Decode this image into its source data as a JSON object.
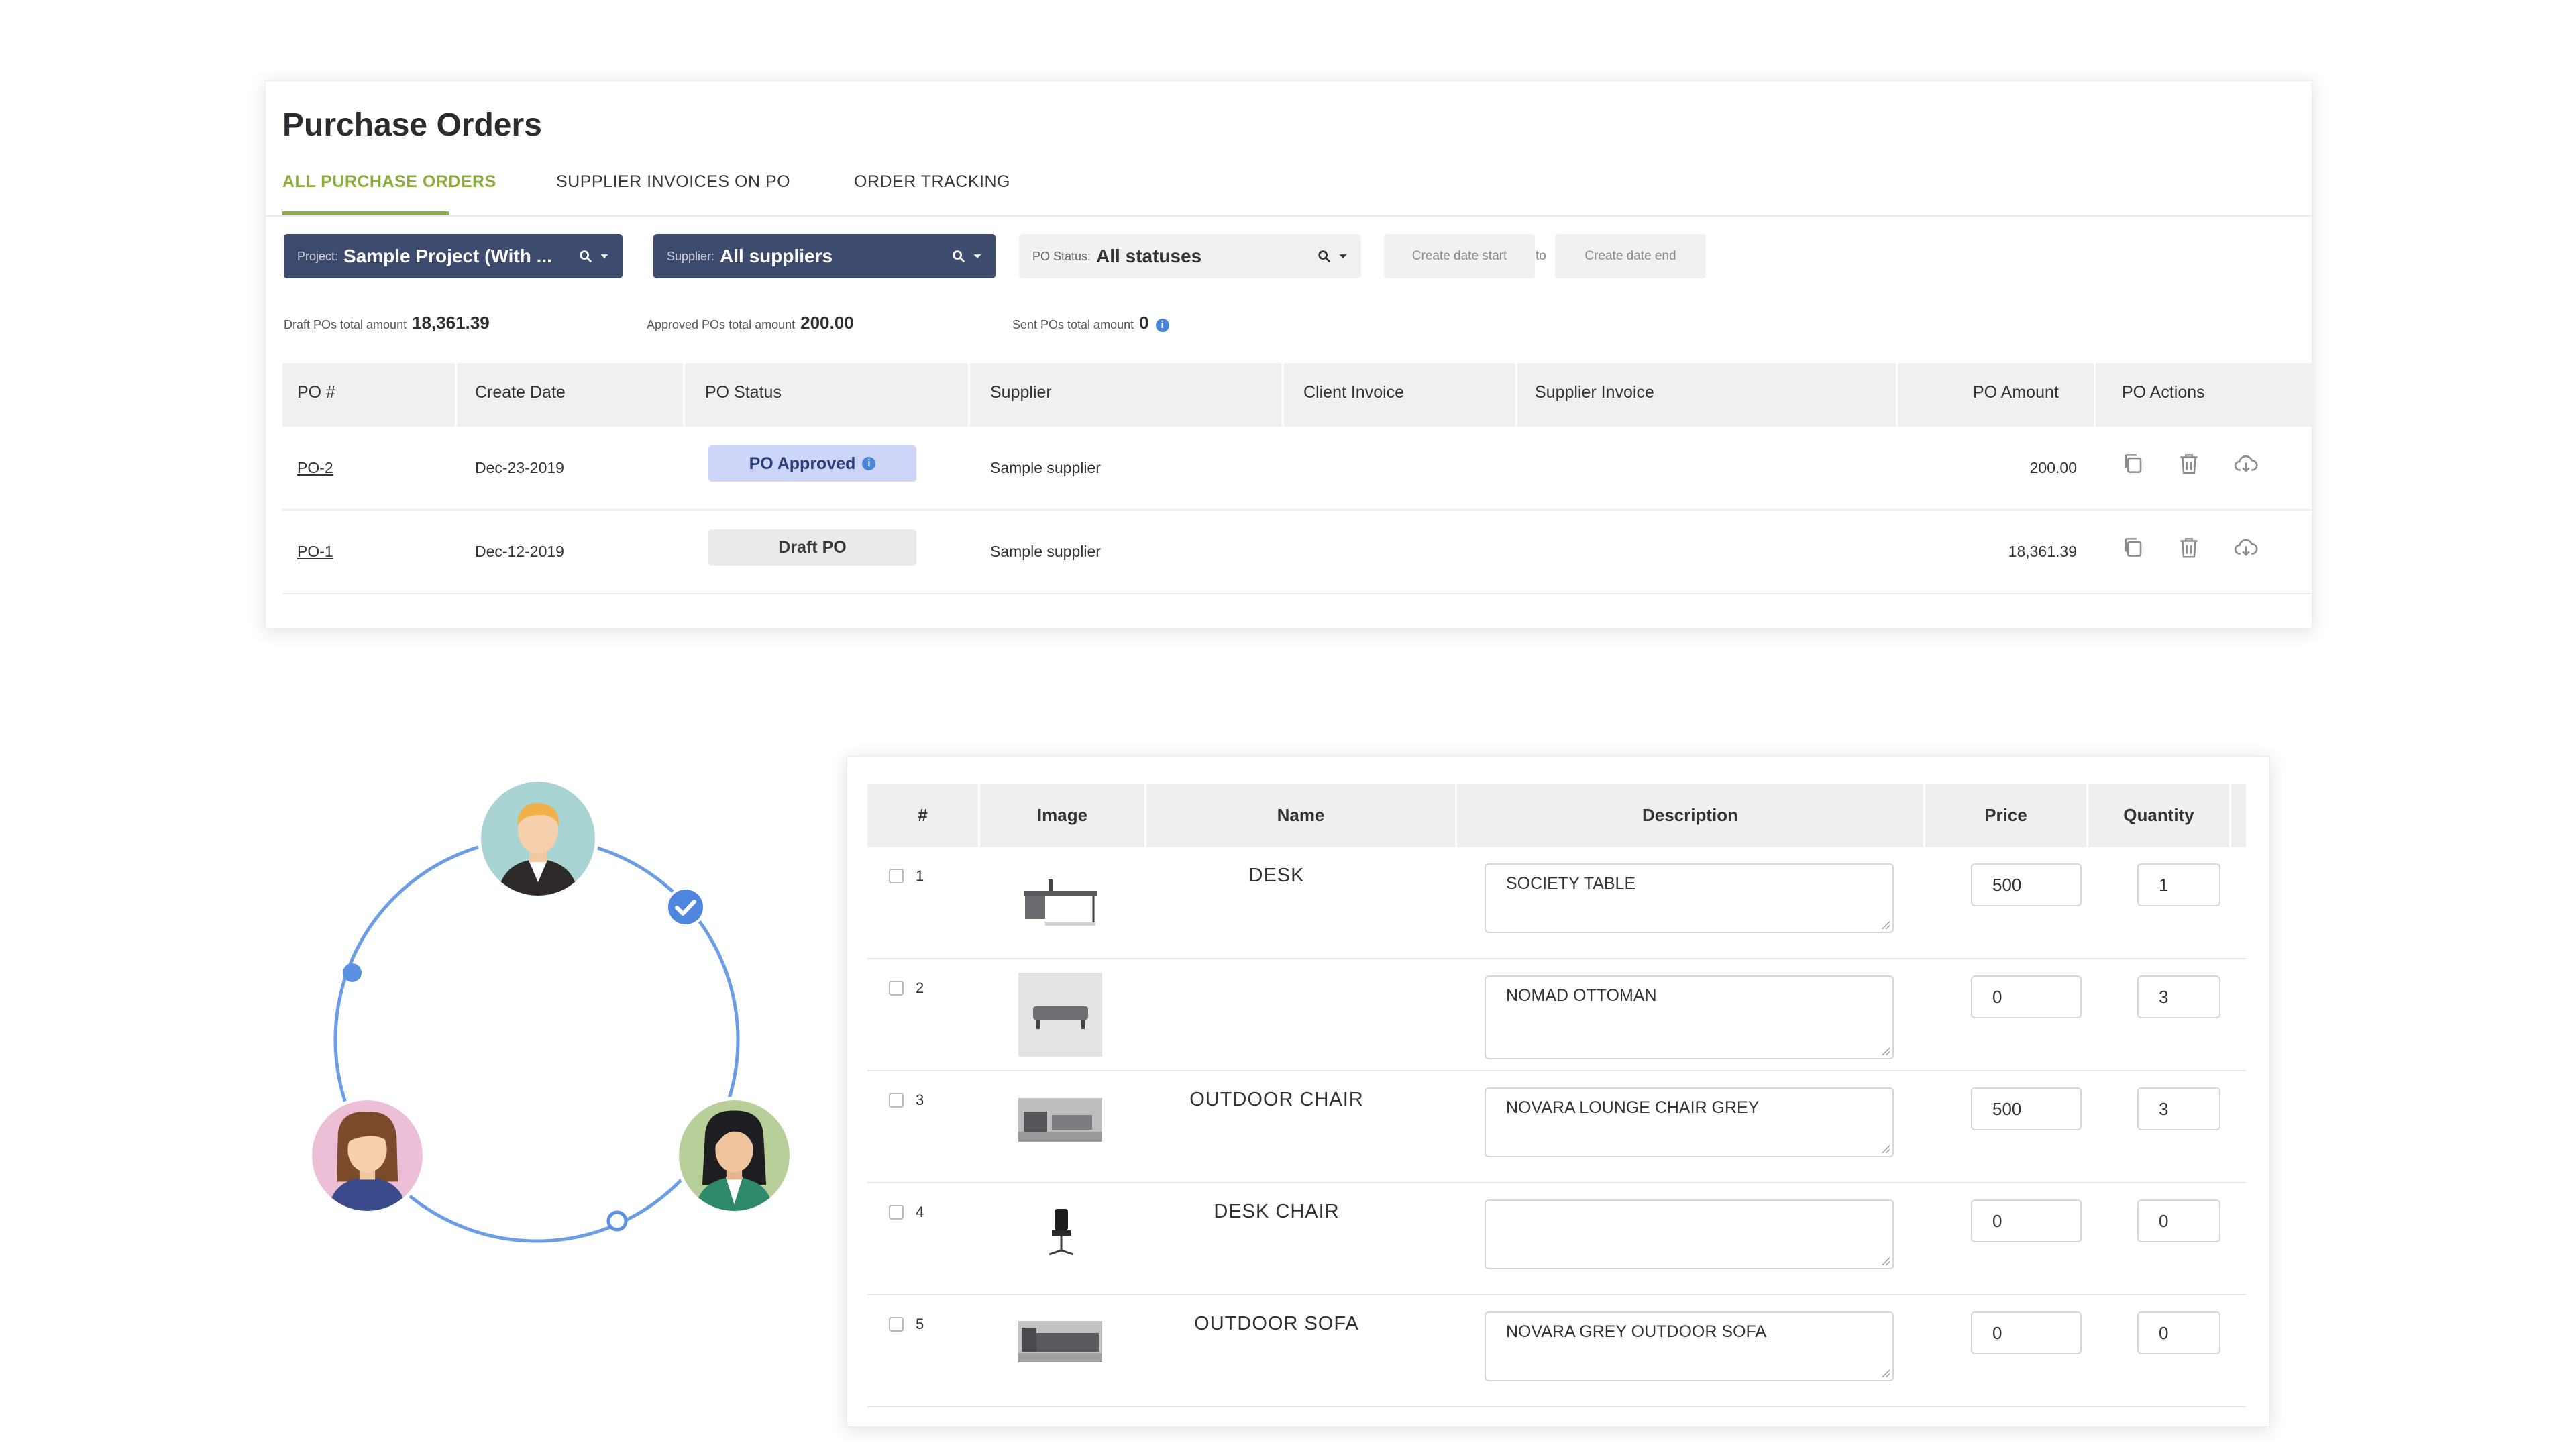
{
  "po_page": {
    "title": "Purchase Orders",
    "tabs": [
      "ALL PURCHASE ORDERS",
      "SUPPLIER INVOICES ON PO",
      "ORDER TRACKING"
    ],
    "active_tab": 0,
    "filters": {
      "project": {
        "label": "Project:",
        "value": "Sample Project (With ..."
      },
      "supplier": {
        "label": "Supplier:",
        "value": "All suppliers"
      },
      "status": {
        "label": "PO Status:",
        "value": "All statuses"
      },
      "date_start_placeholder": "Create date start",
      "date_to": "to",
      "date_end_placeholder": "Create date end"
    },
    "totals": {
      "draft": {
        "label": "Draft POs total amount",
        "value": "18,361.39"
      },
      "approved": {
        "label": "Approved POs total amount",
        "value": "200.00"
      },
      "sent": {
        "label": "Sent POs total amount",
        "value": "0"
      }
    },
    "columns": [
      "PO #",
      "Create Date",
      "PO Status",
      "Supplier",
      "Client Invoice",
      "Supplier Invoice",
      "PO Amount",
      "PO Actions"
    ],
    "rows": [
      {
        "po": "PO-2",
        "date": "Dec-23-2019",
        "status": "PO Approved",
        "status_kind": "approved",
        "supplier": "Sample supplier",
        "client_invoice": "",
        "supplier_invoice": "",
        "amount": "200.00"
      },
      {
        "po": "PO-1",
        "date": "Dec-12-2019",
        "status": "Draft PO",
        "status_kind": "draft",
        "supplier": "Sample supplier",
        "client_invoice": "",
        "supplier_invoice": "",
        "amount": "18,361.39"
      }
    ],
    "row_actions": [
      "copy-icon",
      "trash-icon",
      "cloud-download-icon"
    ],
    "colors": {
      "accent_green": "#8cad3d",
      "filter_dark": "#3d4b6e",
      "approved_badge": "#cdd6f8",
      "link_blue": "#3b6fd0"
    }
  },
  "illustration": {
    "avatars": [
      "man-avatar",
      "woman-avatar-pink",
      "woman-avatar-green"
    ],
    "icons": [
      "check-circle-icon"
    ]
  },
  "product_table": {
    "columns": [
      "#",
      "Image",
      "Name",
      "Description",
      "Price",
      "Quantity"
    ],
    "rows": [
      {
        "num": "1",
        "image": "desk-image",
        "name": "DESK",
        "description": "SOCIETY TABLE",
        "price": "500",
        "quantity": "1"
      },
      {
        "num": "2",
        "image": "ottoman-image",
        "name": "",
        "description": "NOMAD OTTOMAN",
        "price": "0",
        "quantity": "3"
      },
      {
        "num": "3",
        "image": "outdoor-chair-image",
        "name": "OUTDOOR CHAIR",
        "description": "NOVARA LOUNGE CHAIR GREY",
        "price": "500",
        "quantity": "3"
      },
      {
        "num": "4",
        "image": "desk-chair-image",
        "name": "DESK CHAIR",
        "description": "",
        "price": "0",
        "quantity": "0"
      },
      {
        "num": "5",
        "image": "outdoor-sofa-image",
        "name": "OUTDOOR SOFA",
        "description": "NOVARA GREY OUTDOOR SOFA",
        "price": "0",
        "quantity": "0"
      }
    ]
  }
}
